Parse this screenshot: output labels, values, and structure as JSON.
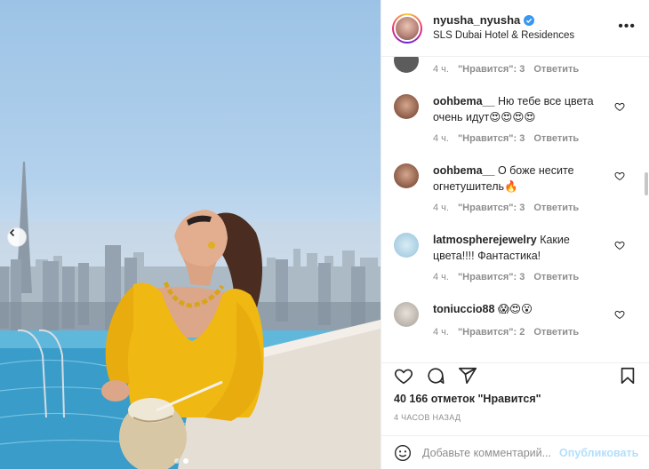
{
  "post": {
    "username": "nyusha_nyusha",
    "location": "SLS Dubai Hotel & Residences",
    "more_label": "•••",
    "photo_alt": "Woman in yellow dress by rooftop pool with Dubai skyline"
  },
  "carousel": {
    "total_slides": 2,
    "active_slide": 2
  },
  "comments": [
    {
      "username": "",
      "text": "",
      "time": "4 ч.",
      "likes": "\"Нравится\": 3",
      "reply": "Ответить",
      "avatar_color": "#6a6a6a",
      "partial": true
    },
    {
      "username": "oohbema__",
      "text": "Ню тебе все цвета очень идут😍😍😍😍",
      "time": "4 ч.",
      "likes": "\"Нравится\": 3",
      "reply": "Ответить",
      "avatar_color": "#8a5a45"
    },
    {
      "username": "oohbema__",
      "text": "О боже несите огнетушитель🔥",
      "time": "4 ч.",
      "likes": "\"Нравится\": 3",
      "reply": "Ответить",
      "avatar_color": "#8a5a45"
    },
    {
      "username": "latmospherejewelry",
      "text": "Какие цвета!!!! Фантастика!",
      "time": "4 ч.",
      "likes": "\"Нравится\": 3",
      "reply": "Ответить",
      "avatar_color": "#a9cfe3"
    },
    {
      "username": "toniuccio88",
      "text": "😱😍😮",
      "time": "4 ч.",
      "likes": "\"Нравится\": 2",
      "reply": "Ответить",
      "avatar_color": "#b8b2aa"
    }
  ],
  "stats": {
    "likes_total": "40 166 отметок \"Нравится\"",
    "time_ago": "4 ЧАСОВ НАЗАД"
  },
  "composer": {
    "placeholder": "Добавьте комментарий...",
    "publish_label": "Опубликовать"
  },
  "colors": {
    "accent": "#0095f6",
    "publish_disabled": "#b2dffc",
    "verified": "#3897f0",
    "dress": "#f0b812"
  }
}
